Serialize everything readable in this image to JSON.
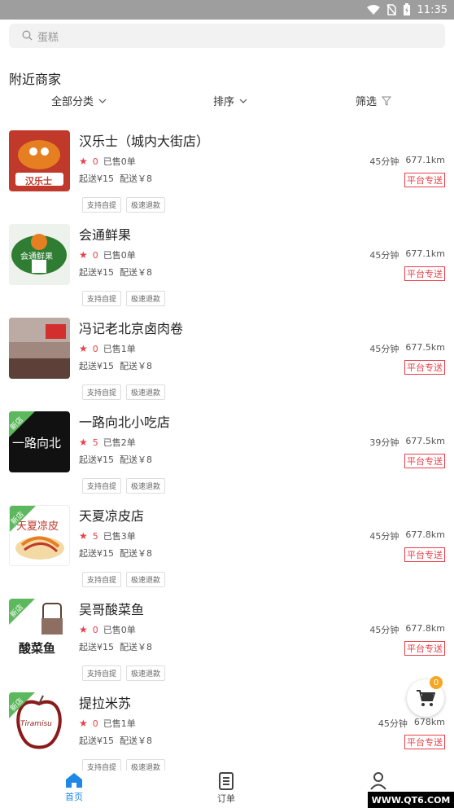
{
  "status_bar": {
    "time": "11:35"
  },
  "search": {
    "placeholder": "蛋糕"
  },
  "section_title": "附近商家",
  "filters": {
    "category": "全部分类",
    "sort": "排序",
    "filter": "筛选"
  },
  "merchants": [
    {
      "name": "汉乐士（城内大街店）",
      "rating": "0",
      "sold": "已售0单",
      "min_order": "起送¥15",
      "delivery_fee": "配送￥8",
      "time": "45分钟",
      "distance": "677.1km",
      "delivery": "平台专送",
      "tags": [
        "支持自提",
        "极速退款"
      ],
      "new": false,
      "thumb_text": "汉乐士"
    },
    {
      "name": "会通鲜果",
      "rating": "0",
      "sold": "已售0单",
      "min_order": "起送¥15",
      "delivery_fee": "配送￥8",
      "time": "45分钟",
      "distance": "677.1km",
      "delivery": "平台专送",
      "tags": [
        "支持自提",
        "极速退款"
      ],
      "new": false,
      "thumb_text": "会通鲜果"
    },
    {
      "name": "冯记老北京卤肉卷",
      "rating": "0",
      "sold": "已售1单",
      "min_order": "起送¥15",
      "delivery_fee": "配送￥8",
      "time": "45分钟",
      "distance": "677.5km",
      "delivery": "平台专送",
      "tags": [
        "支持自提",
        "极速退款"
      ],
      "new": false,
      "thumb_text": ""
    },
    {
      "name": "一路向北小吃店",
      "rating": "5",
      "sold": "已售2单",
      "min_order": "起送¥15",
      "delivery_fee": "配送￥8",
      "time": "39分钟",
      "distance": "677.5km",
      "delivery": "平台专送",
      "tags": [
        "支持自提",
        "极速退款"
      ],
      "new": true,
      "thumb_text": "一路向北"
    },
    {
      "name": "天夏凉皮店",
      "rating": "5",
      "sold": "已售3单",
      "min_order": "起送¥15",
      "delivery_fee": "配送￥8",
      "time": "45分钟",
      "distance": "677.8km",
      "delivery": "平台专送",
      "tags": [
        "支持自提",
        "极速退款"
      ],
      "new": true,
      "thumb_text": "天夏凉皮"
    },
    {
      "name": "吴哥酸菜鱼",
      "rating": "0",
      "sold": "已售0单",
      "min_order": "起送¥15",
      "delivery_fee": "配送￥8",
      "time": "45分钟",
      "distance": "677.8km",
      "delivery": "平台专送",
      "tags": [
        "支持自提",
        "极速退款"
      ],
      "new": true,
      "thumb_text": "酸菜鱼"
    },
    {
      "name": "提拉米苏",
      "rating": "0",
      "sold": "已售1单",
      "min_order": "起送¥15",
      "delivery_fee": "配送￥8",
      "time": "45分钟",
      "distance": "678km",
      "delivery": "平台专送",
      "tags": [
        "支持自提",
        "极速退款"
      ],
      "new": true,
      "thumb_text": "Tiramisu"
    }
  ],
  "new_tag_label": "新店",
  "cart": {
    "count": "0"
  },
  "tabs": [
    {
      "label": "首页",
      "active": true
    },
    {
      "label": "订单",
      "active": false
    },
    {
      "label": "我的",
      "active": false
    }
  ],
  "watermark": "WWW.QT6.COM",
  "colors": {
    "accent": "#1e88e5",
    "price_red": "#e8414a",
    "new_green": "#5cb85c",
    "cart_badge": "#f5a623"
  }
}
